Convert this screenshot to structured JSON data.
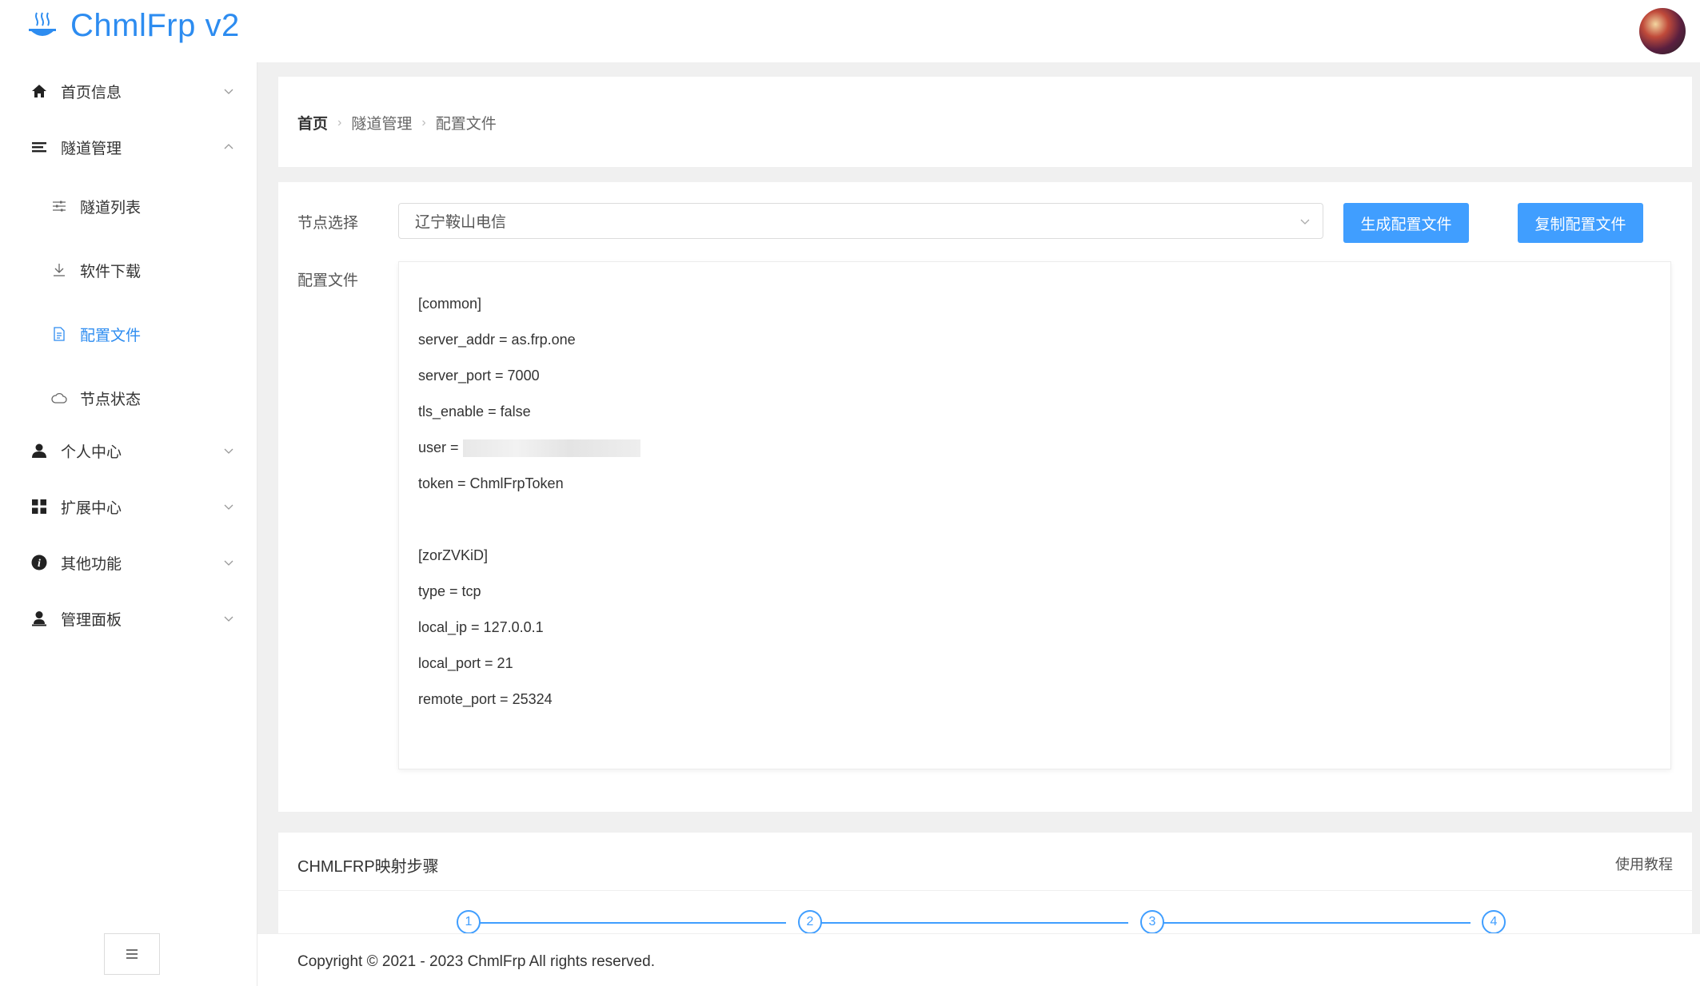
{
  "app": {
    "title": "ChmlFrp v2"
  },
  "sidebar": {
    "items": [
      {
        "label": "首页信息",
        "icon": "home-icon",
        "expanded": false
      },
      {
        "label": "隧道管理",
        "icon": "list-icon",
        "expanded": true
      },
      {
        "label": "个人中心",
        "icon": "user-icon",
        "expanded": false
      },
      {
        "label": "扩展中心",
        "icon": "grid-icon",
        "expanded": false
      },
      {
        "label": "其他功能",
        "icon": "info-icon",
        "expanded": false
      },
      {
        "label": "管理面板",
        "icon": "admin-icon",
        "expanded": false
      }
    ],
    "subitems": [
      {
        "label": "隧道列表",
        "icon": "sliders-icon",
        "active": false
      },
      {
        "label": "软件下载",
        "icon": "download-icon",
        "active": false
      },
      {
        "label": "配置文件",
        "icon": "document-icon",
        "active": true
      },
      {
        "label": "节点状态",
        "icon": "cloud-icon",
        "active": false
      }
    ],
    "collapse_icon": "menu-collapse-icon"
  },
  "breadcrumb": [
    "首页",
    "隧道管理",
    "配置文件"
  ],
  "form": {
    "node_label": "节点选择",
    "node_selected": "辽宁鞍山电信",
    "config_label": "配置文件",
    "generate_button": "生成配置文件",
    "copy_button": "复制配置文件"
  },
  "config": {
    "lines": [
      "[common]",
      "server_addr = as.frp.one",
      "server_port = 7000",
      "tls_enable = false",
      "user = ",
      "token = ChmlFrpToken",
      "",
      "[zorZVKiD]",
      "type = tcp",
      "local_ip = 127.0.0.1",
      "local_port = 21",
      "remote_port = 25324"
    ]
  },
  "steps": {
    "title": "CHMLFRP映射步骤",
    "link": "使用教程",
    "numbers": [
      "1",
      "2",
      "3",
      "4"
    ]
  },
  "footer": {
    "text": "Copyright © 2021 - 2023 ChmlFrp All rights reserved."
  },
  "colors": {
    "accent": "#409eff",
    "brand": "#2d8cf0"
  }
}
